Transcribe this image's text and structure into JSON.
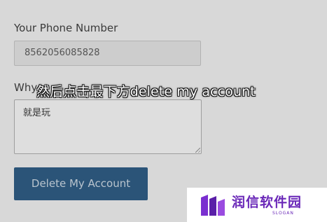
{
  "form": {
    "phone_label": "Your Phone Number",
    "phone_value": "8562056085828",
    "reason_label_partial": "Why",
    "reason_value": "就是玩",
    "delete_button_label": "Delete My Account"
  },
  "overlay": {
    "subtitle": "然后点击最下方delete my account"
  },
  "watermark": {
    "name": "润信软件园",
    "slogan": "SLOGAN",
    "logo_icon": "purple-bars-logo",
    "brand_color": "#6a28b8"
  },
  "colors": {
    "background": "#d8d8d8",
    "button": "#2b5478",
    "button_text": "#b9c4ce"
  }
}
